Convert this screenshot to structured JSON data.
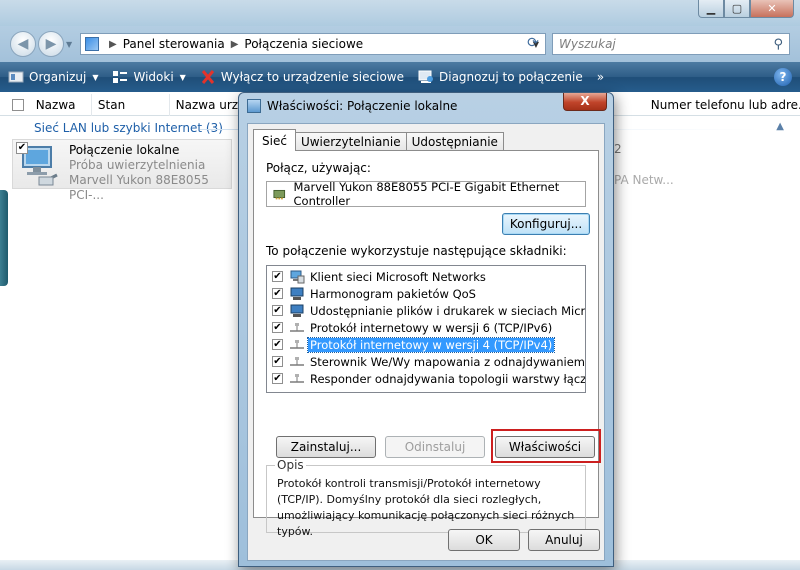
{
  "explorer": {
    "address": {
      "segment1": "Panel sterowania",
      "segment2": "Połączenia sieciowe"
    },
    "search_placeholder": "Wyszukaj",
    "toolbar": {
      "organize": "Organizuj",
      "views": "Widoki",
      "disable": "Wyłącz to urządzenie sieciowe",
      "diagnose": "Diagnozuj to połączenie",
      "more": "»"
    },
    "columns": {
      "name": "Nazwa",
      "status": "Stan",
      "device": "Nazwa urząd",
      "phone": "Numer telefonu lub adre..."
    },
    "group_header": "Sieć LAN lub szybki Internet (3)",
    "connection": {
      "name": "Połączenie lokalne",
      "status": "Próba uwierzytelnienia",
      "device": "Marvell Yukon 88E8055 PCI-..."
    },
    "bg_text1": "2",
    "bg_text2": "PA Netw..."
  },
  "dialog": {
    "title": "Właściwości: Połączenie lokalne",
    "tabs": [
      "Sieć",
      "Uwierzytelnianie",
      "Udostępnianie"
    ],
    "connect_using_label": "Połącz, używając:",
    "adapter": "Marvell Yukon 88E8055 PCI-E Gigabit Ethernet Controller",
    "configure_button": "Konfiguruj...",
    "components_label": "To połączenie wykorzystuje następujące składniki:",
    "components": [
      {
        "label": "Klient sieci Microsoft Networks",
        "checked": true,
        "icon": "network-client-icon"
      },
      {
        "label": "Harmonogram pakietów QoS",
        "checked": true,
        "icon": "qos-icon"
      },
      {
        "label": "Udostępnianie plików i drukarek w sieciach Microsoft N...",
        "checked": true,
        "icon": "file-sharing-icon"
      },
      {
        "label": "Protokół internetowy w wersji 6 (TCP/IPv6)",
        "checked": true,
        "icon": "protocol-icon"
      },
      {
        "label": "Protokół internetowy w wersji 4 (TCP/IPv4)",
        "checked": true,
        "icon": "protocol-icon",
        "selected": true
      },
      {
        "label": "Sterownik We/Wy mapowania z odnajdywaniem topolo...",
        "checked": true,
        "icon": "protocol-icon"
      },
      {
        "label": "Responder odnajdywania topologii warstwy łącza",
        "checked": true,
        "icon": "protocol-icon"
      }
    ],
    "install_button": "Zainstaluj...",
    "uninstall_button": "Odinstaluj",
    "properties_button": "Właściwości",
    "description_legend": "Opis",
    "description": "Protokół kontroli transmisji/Protokół internetowy (TCP/IP). Domyślny protokół dla sieci rozległych, umożliwiający komunikację połączonych sieci różnych typów.",
    "ok_button": "OK",
    "cancel_button": "Anuluj",
    "close_glyph": "X"
  },
  "colors": {
    "toolbar": "#265c8c",
    "selection": "#3399ff",
    "highlight_frame": "#cc1f1f",
    "group_header": "#1e5fa8"
  }
}
